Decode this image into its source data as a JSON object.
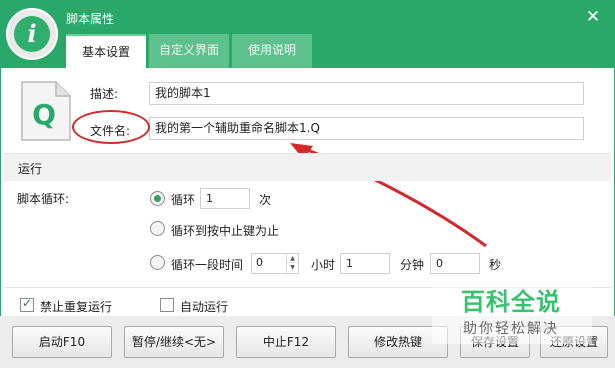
{
  "window": {
    "title": "脚本属性",
    "close_glyph": "✕",
    "logo_glyph": "i"
  },
  "tabs": [
    {
      "label": "基本设置",
      "active": true
    },
    {
      "label": "自定义界面",
      "active": false
    },
    {
      "label": "使用说明",
      "active": false
    }
  ],
  "file_icon": {
    "glyph": "Q"
  },
  "fields": {
    "description": {
      "label": "描述:",
      "value": "我的脚本1"
    },
    "filename": {
      "label": "文件名:",
      "value": "我的第一个辅助重命名脚本1.Q"
    }
  },
  "run_section": {
    "title": "运行",
    "loop_label": "脚本循环:",
    "options": {
      "loop": {
        "label": "循环",
        "count": "1",
        "unit": "次",
        "selected": true
      },
      "until_stop": {
        "label": "循环到按中止键为止",
        "selected": false
      },
      "duration": {
        "label": "循环一段时间",
        "hours": "0",
        "hours_unit": "小时",
        "minutes": "1",
        "minutes_unit": "分钟",
        "seconds": "0",
        "seconds_unit": "秒",
        "selected": false
      }
    }
  },
  "checkboxes": {
    "no_repeat": {
      "label": "禁止重复运行",
      "checked": true
    },
    "autorun": {
      "label": "自动运行",
      "checked": false
    }
  },
  "buttons": {
    "start": "启动F10",
    "pause": "暂停/继续<无>",
    "stop": "中止F12",
    "hotkey": "修改热键",
    "save": "保存设置",
    "restore": "还原设置"
  },
  "watermark": {
    "title": "百科全说",
    "subtitle": "助你轻松解决"
  },
  "colors": {
    "header": "#2aa86a",
    "annotation": "#d22a2a",
    "watermark": "#39c16f"
  }
}
